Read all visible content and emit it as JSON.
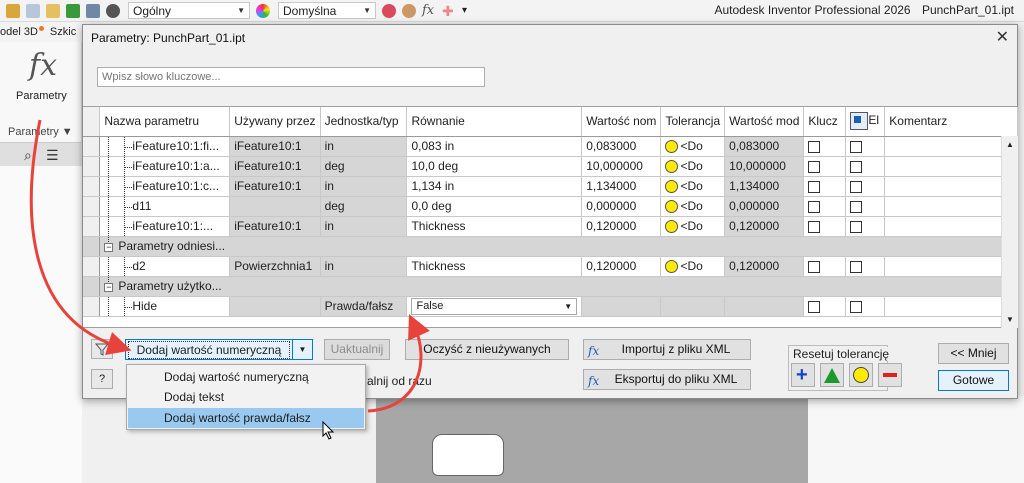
{
  "app": {
    "title": "Autodesk Inventor Professional 2026",
    "file": "PunchPart_01.ipt",
    "combo_style": "Ogólny",
    "combo_appearance": "Domyślna"
  },
  "ribbon": {
    "tab_model": "odel 3D",
    "tab_sketch": "Szkic",
    "button_label": "Parametry",
    "panel_label": "Parametry ▼"
  },
  "dialog": {
    "title": "Parametry: PunchPart_01.ipt",
    "search_placeholder": "Wpisz słowo kluczowe..."
  },
  "columns": [
    "Nazwa parametru",
    "Używany przez",
    "Jednostka/typ",
    "Równanie",
    "Wartość nom",
    "Tolerancja",
    "Wartość mod",
    "Klucz",
    "El",
    "Komentarz"
  ],
  "rows": [
    {
      "name": "iFeature10:1:fi...",
      "used": "iFeature10:1",
      "unit": "in",
      "eq": "0,083 in",
      "nom": "0,083000",
      "tol": "<Do",
      "mod": "0,083000"
    },
    {
      "name": "iFeature10:1:a...",
      "used": "iFeature10:1",
      "unit": "deg",
      "eq": "10,0 deg",
      "nom": "10,000000",
      "tol": "<Do",
      "mod": "10,000000"
    },
    {
      "name": "iFeature10:1:c...",
      "used": "iFeature10:1",
      "unit": "in",
      "eq": "1,134 in",
      "nom": "1,134000",
      "tol": "<Do",
      "mod": "1,134000"
    },
    {
      "name": "d11",
      "used": "",
      "unit": "deg",
      "eq": "0,0 deg",
      "nom": "0,000000",
      "tol": "<Do",
      "mod": "0,000000"
    },
    {
      "name": "iFeature10:1:...",
      "used": "iFeature10:1",
      "unit": "in",
      "eq": "Thickness",
      "nom": "0,120000",
      "tol": "<Do",
      "mod": "0,120000"
    }
  ],
  "group_ref": "Parametry odniesi...",
  "ref_row": {
    "name": "d2",
    "used": "Powierzchnia1",
    "unit": "in",
    "eq": "Thickness",
    "nom": "0,120000",
    "tol": "<Do",
    "mod": "0,120000"
  },
  "group_user": "Parametry użytko...",
  "user_row": {
    "name": "Hide",
    "unit": "Prawda/fałsz",
    "eq": "False"
  },
  "buttons": {
    "add": "Dodaj wartość numeryczną",
    "update": "Uaktualnij",
    "purge": "Oczyść z nieużywanych",
    "import": "Importuj z pliku XML",
    "export": "Eksportuj do pliku XML",
    "less": "<< Mniej",
    "done": "Gotowe",
    "help": "?"
  },
  "immediate_label": "alnij od razu",
  "reset_tolerance": "Resetuj tolerancję",
  "menu": [
    "Dodaj wartość numeryczną",
    "Dodaj tekst",
    "Dodaj wartość prawda/fałsz"
  ],
  "colors": {
    "accent": "#0078d7",
    "highlight": "#99c9ef",
    "annotation_arrow": "#e8433a"
  }
}
